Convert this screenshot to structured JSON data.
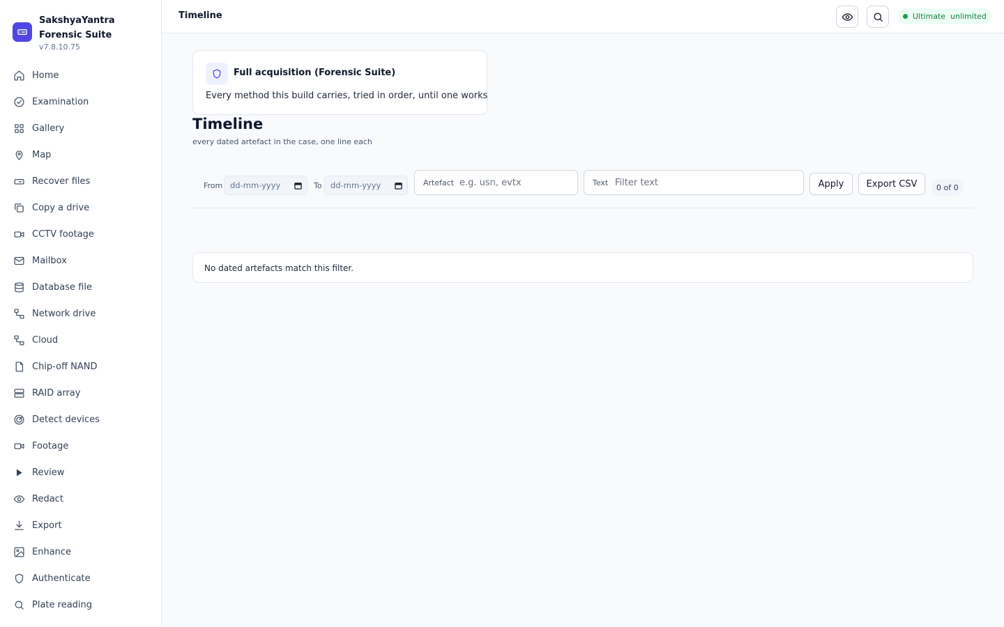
{
  "app": {
    "title": "SakshyaYantra Forensic Suite",
    "version": "v7.8.10.75",
    "logo_icon": "drive-icon",
    "accent_color": "#4f46e5"
  },
  "sidebar": {
    "items": [
      {
        "label": "Home",
        "icon": "home-icon"
      },
      {
        "label": "Examination",
        "icon": "check-circle-icon"
      },
      {
        "label": "Gallery",
        "icon": "grid-icon"
      },
      {
        "label": "Map",
        "icon": "map-pin-icon"
      },
      {
        "label": "Recover files",
        "icon": "hard-drive-icon"
      },
      {
        "label": "Copy a drive",
        "icon": "copy-icon"
      },
      {
        "label": "CCTV footage",
        "icon": "video-icon"
      },
      {
        "label": "Mailbox",
        "icon": "mail-icon"
      },
      {
        "label": "Database file",
        "icon": "database-icon"
      },
      {
        "label": "Network drive",
        "icon": "network-icon"
      },
      {
        "label": "Cloud",
        "icon": "network-icon"
      },
      {
        "label": "Chip-off NAND",
        "icon": "file-icon"
      },
      {
        "label": "RAID array",
        "icon": "server-icon"
      },
      {
        "label": "Detect devices",
        "icon": "radar-icon"
      },
      {
        "label": "Footage",
        "icon": "video-icon"
      },
      {
        "label": "Review",
        "icon": "play-icon"
      },
      {
        "label": "Redact",
        "icon": "eye-icon"
      },
      {
        "label": "Export",
        "icon": "download-icon"
      },
      {
        "label": "Enhance",
        "icon": "image-icon"
      },
      {
        "label": "Authenticate",
        "icon": "shield-icon"
      },
      {
        "label": "Plate reading",
        "icon": "search-icon"
      }
    ]
  },
  "header": {
    "title": "Timeline",
    "plan_badge": "Ultimate  unlimited",
    "plan_color": "#16a34a"
  },
  "acquisition": {
    "title": "Full acquisition (Forensic Suite)",
    "description": "Every method this build carries, tried in order, until one works",
    "icon": "shield-icon"
  },
  "page": {
    "title": "Timeline",
    "subtitle": "every dated artefact in the case, one line each"
  },
  "filters": {
    "from_label": "From",
    "from_placeholder": "dd-mm-yyyy",
    "to_label": "To",
    "to_placeholder": "dd-mm-yyyy",
    "artefact_label": "Artefact",
    "artefact_placeholder": "e.g. usn, evtx",
    "text_label": "Text",
    "text_placeholder": "Filter text",
    "apply_label": "Apply",
    "export_label": "Export CSV",
    "count": "0 of 0"
  },
  "results": {
    "empty_message": "No dated artefacts match this filter."
  }
}
